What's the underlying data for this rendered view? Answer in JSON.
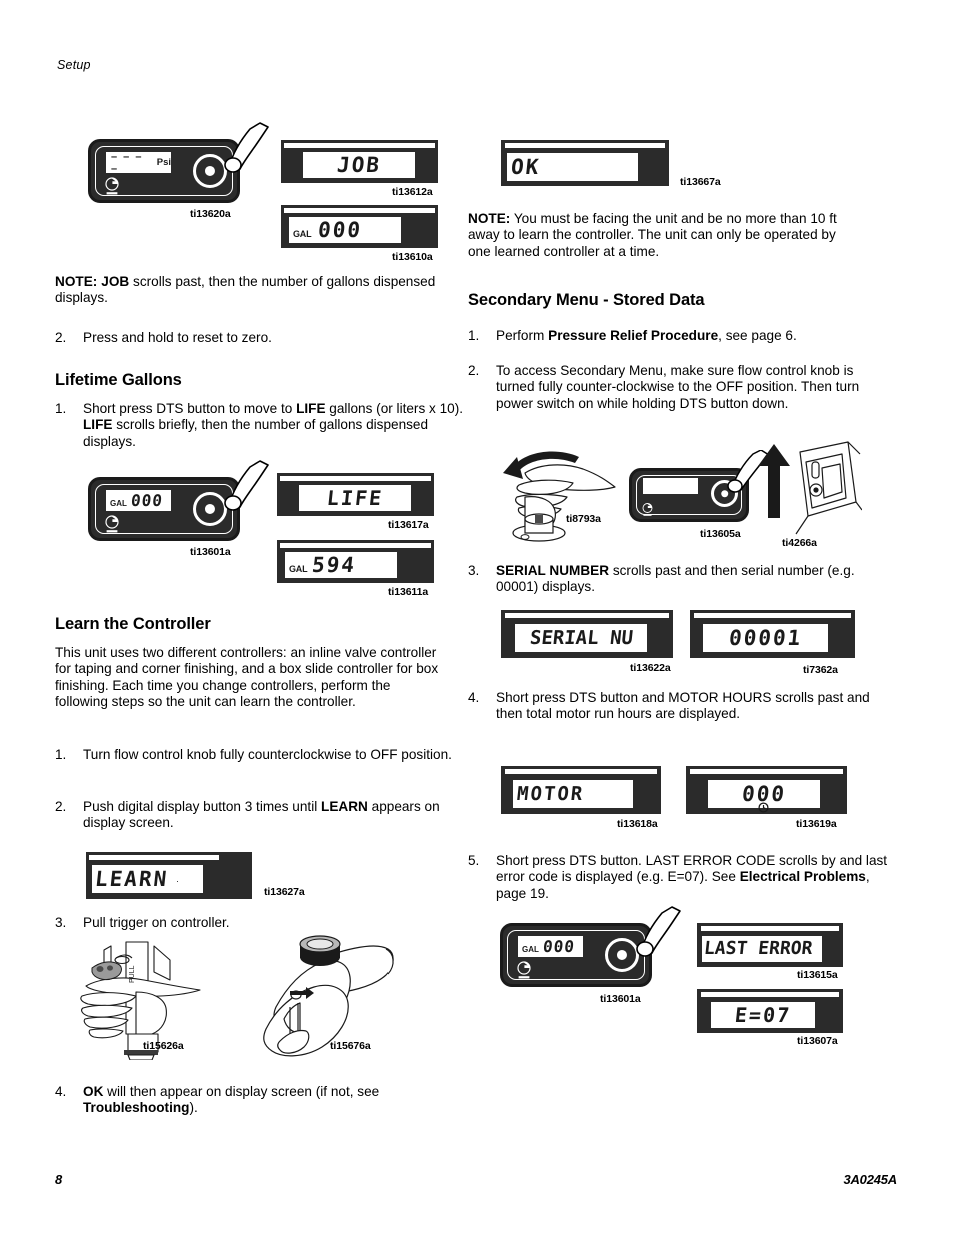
{
  "header": {
    "running_head": "Setup"
  },
  "footer": {
    "page_number": "8",
    "document_number": "3A0245A"
  },
  "left_column": {
    "figures_top": [
      {
        "id": "ti13620a",
        "type": "unit-face",
        "display_text": "– – – –",
        "display_unit": "Psi"
      },
      {
        "id": "ti13612a",
        "type": "lcd",
        "display_text": "JOB"
      },
      {
        "id": "ti13610a",
        "type": "lcd",
        "display_text": "000",
        "indicator": "GAL"
      }
    ],
    "note_job": {
      "label": "NOTE:",
      "bold_term": "JOB",
      "text": " scrolls past, then the number of gallons dispensed displays."
    },
    "step_reset": {
      "number": "2.",
      "text": "Press and hold to reset to zero."
    },
    "heading_lifetime": "Lifetime Gallons",
    "step_lifetime": {
      "number": "1.",
      "part1": "Short press DTS button to move to ",
      "bold1": "LIFE",
      "part2": " gallons (or liters x 10). ",
      "bold2": "LIFE",
      "part3": " scrolls briefly, then the number of gallons dispensed displays."
    },
    "figures_lifetime": [
      {
        "id": "ti13601a",
        "type": "unit-face",
        "display_text": "000",
        "indicator": "GAL"
      },
      {
        "id": "ti13617a",
        "type": "lcd",
        "display_text": "LIFE"
      },
      {
        "id": "ti13611a",
        "type": "lcd",
        "display_text": "594",
        "indicator": "GAL"
      }
    ],
    "heading_learn": "Learn the Controller",
    "para_learn": "This unit uses two different controllers: an inline valve controller for taping and corner finishing, and a box slide controller for box finishing. Each time you change controllers, perform the following steps so the unit can learn the controller.",
    "step_learn_1": {
      "number": "1.",
      "text": "Turn flow control knob fully counterclockwise to OFF position."
    },
    "step_learn_2": {
      "number": "2.",
      "part1": "Push digital display button 3 times until ",
      "bold1": "LEARN",
      "part2": " appears on display screen."
    },
    "figure_learn": {
      "id": "ti13627a",
      "type": "lcd",
      "display_text": "LEARN"
    },
    "step_learn_3": {
      "number": "3.",
      "text": "Pull trigger on controller."
    },
    "figures_trigger": [
      {
        "id": "ti15626a",
        "type": "illustration-hand-trigger"
      },
      {
        "id": "ti15676a",
        "type": "illustration-box-controller"
      }
    ],
    "step_learn_4": {
      "number": "4.",
      "bold1": "OK",
      "part1": " will then appear on display screen (if not, see ",
      "bold2": "Troubleshooting",
      "part2": ")."
    }
  },
  "right_column": {
    "figure_ok": {
      "id": "ti13667a",
      "type": "lcd",
      "display_text": "OK"
    },
    "note_learn": {
      "label": "NOTE:",
      "text": " You must be facing the unit and be no more than 10 ft away to learn the controller. The unit can only be operated by one learned controller at a time."
    },
    "heading_secondary": "Secondary Menu - Stored Data",
    "step_1": {
      "number": "1.",
      "part1": "Perform ",
      "bold1": "Pressure Relief Procedure",
      "part2": ", see page 6."
    },
    "step_2": {
      "number": "2.",
      "text": "To access Secondary Menu, make sure flow control knob is turned fully counter-clockwise to the OFF position. Then turn power switch on while holding DTS button down."
    },
    "figures_step2": [
      {
        "id": "ti8793a",
        "type": "illustration-hand-knob"
      },
      {
        "id": "ti13605a",
        "type": "unit-face",
        "display_text": ""
      },
      {
        "id": "ti4266a",
        "type": "illustration-power-switch"
      }
    ],
    "step_3": {
      "number": "3.",
      "bold1": "SERIAL NUMBER",
      "part1": " scrolls past and then serial number (e.g. 00001) displays."
    },
    "figures_step3": [
      {
        "id": "ti13622a",
        "type": "lcd",
        "display_text": "SERIAL NU"
      },
      {
        "id": "ti7362a",
        "type": "lcd",
        "display_text": "00001"
      }
    ],
    "step_4": {
      "number": "4.",
      "text": "Short press DTS button and MOTOR HOURS scrolls past and then total motor run hours are displayed."
    },
    "figures_step4": [
      {
        "id": "ti13618a",
        "type": "lcd",
        "display_text": "MOTOR"
      },
      {
        "id": "ti13619a",
        "type": "lcd",
        "display_text": "000",
        "indicator": "hours"
      }
    ],
    "step_5": {
      "number": "5.",
      "part1": "Short press DTS button. LAST ERROR CODE scrolls by and last error code is displayed (e.g. E=07). See ",
      "bold1": "Electrical Problems",
      "part2": ", page 19."
    },
    "figures_step5": [
      {
        "id": "ti13601a",
        "type": "unit-face",
        "display_text": "000",
        "indicator": "GAL"
      },
      {
        "id": "ti13615a",
        "type": "lcd",
        "display_text": "LAST ERROR"
      },
      {
        "id": "ti13607a",
        "type": "lcd",
        "display_text": "E=07"
      }
    ]
  }
}
